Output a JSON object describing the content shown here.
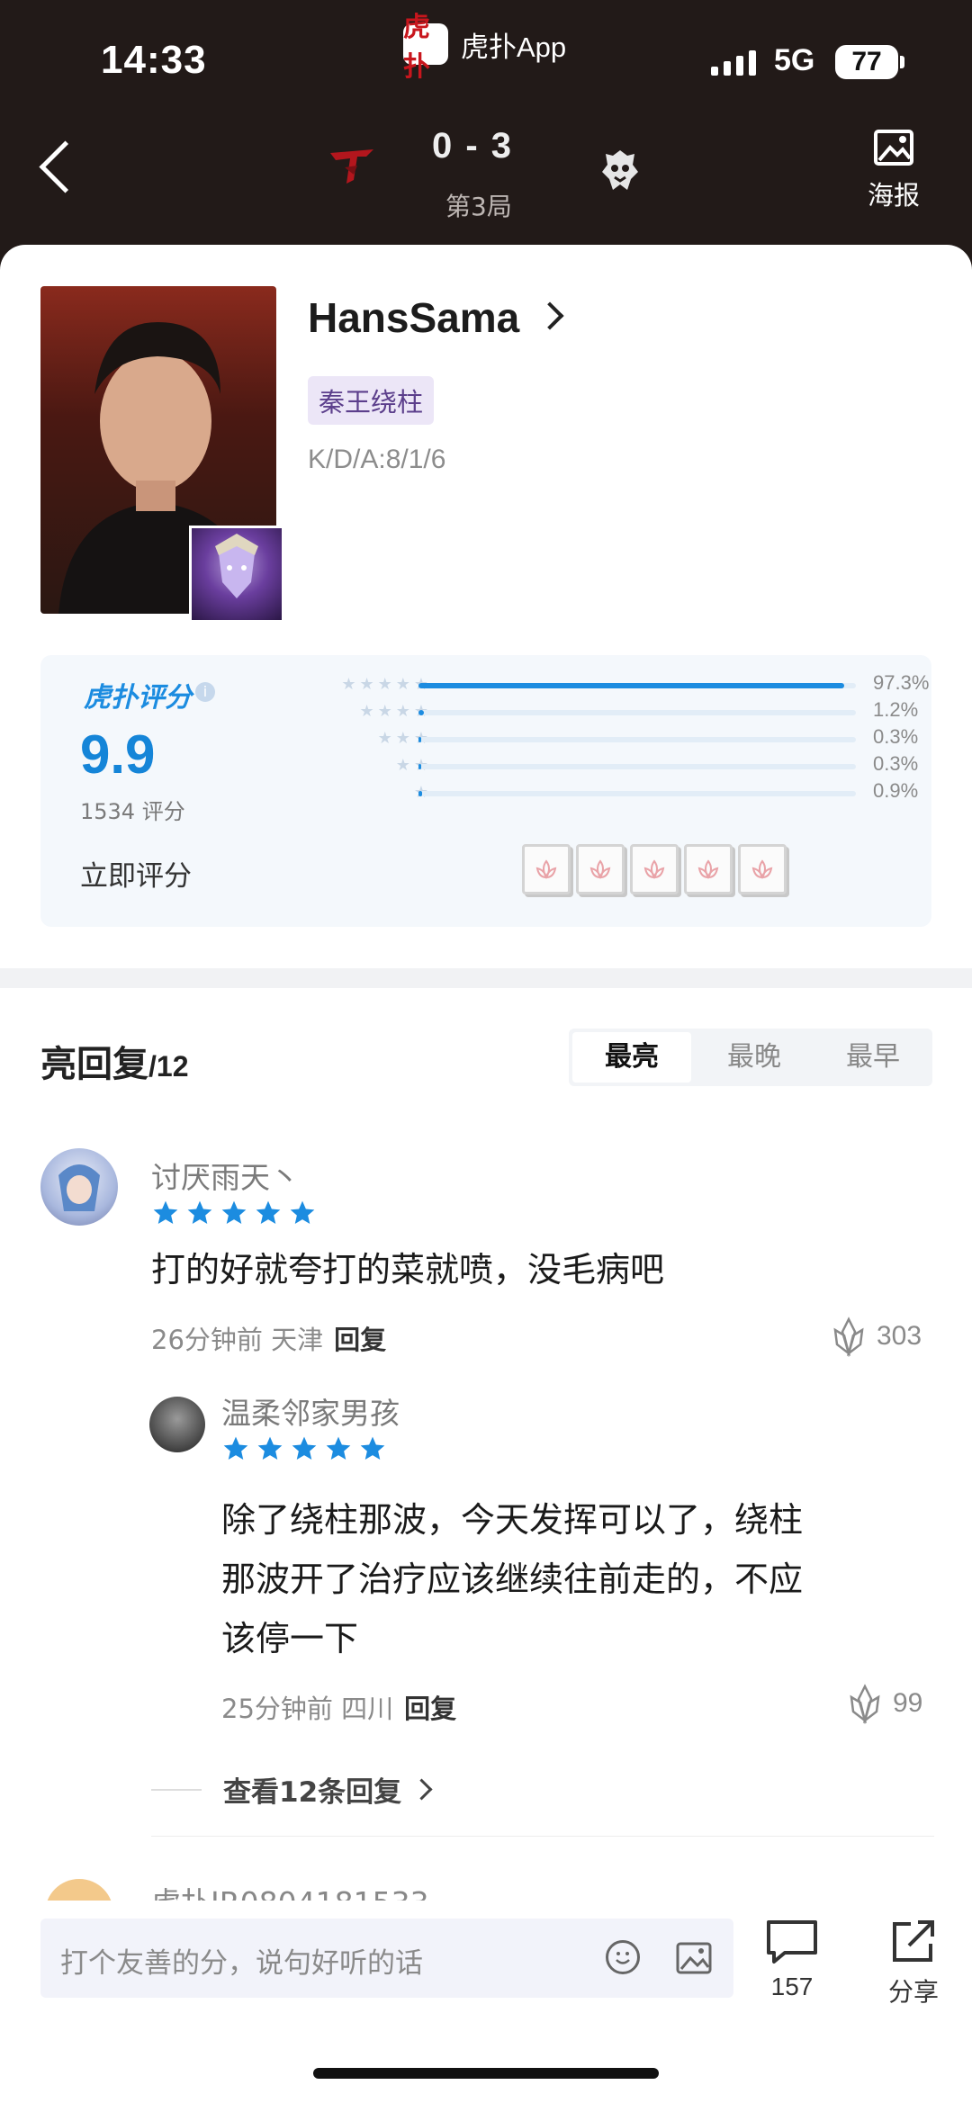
{
  "status_bar": {
    "time": "14:33",
    "app_name": "虎扑App",
    "app_logo_text": "虎扑",
    "network": "5G",
    "battery": "77"
  },
  "header": {
    "score": "0 - 3",
    "round": "第3局",
    "poster_label": "海报"
  },
  "player": {
    "name": "HansSama",
    "tag": "秦王绕柱",
    "kda": "K/D/A:8/1/6"
  },
  "rating": {
    "logo": "虎扑评分",
    "score": "9.9",
    "count": "1534 评分",
    "rate_now": "立即评分",
    "rows": [
      {
        "stars": "★★★★★",
        "fill": 0.973,
        "pct": "97.3%"
      },
      {
        "stars": "★★★★",
        "fill": 0.012,
        "pct": "1.2%"
      },
      {
        "stars": "★★★",
        "fill": 0.003,
        "pct": "0.3%"
      },
      {
        "stars": "★★",
        "fill": 0.003,
        "pct": "0.3%"
      },
      {
        "stars": "★",
        "fill": 0.009,
        "pct": "0.9%"
      }
    ]
  },
  "comments_section": {
    "title": "亮回复",
    "count": "/12",
    "sort": [
      "最亮",
      "最晚",
      "最早"
    ]
  },
  "comments": [
    {
      "user": "讨厌雨天丶",
      "stars": 5,
      "text": "打的好就夸打的菜就喷，没毛病吧",
      "time": "26分钟前 天津",
      "reply": "回复",
      "likes": "303"
    },
    {
      "user": "温柔邻家男孩",
      "stars": 5,
      "text_lines": [
        "除了绕柱那波，今天发挥可以了，绕柱",
        "那波开了治疗应该继续往前走的，不应",
        "该停一下"
      ],
      "time": "25分钟前 四川",
      "reply": "回复",
      "likes": "99"
    }
  ],
  "view_more": "查看12条回复",
  "next_user_partial": "虎扑JR0804181533",
  "bottom_bar": {
    "placeholder": "打个友善的分，说句好听的话",
    "comment_count": "157",
    "share_label": "分享"
  },
  "colors": {
    "header_bg": "#221a18",
    "accent_blue": "#1c8ce0",
    "star_blue": "#1c8ce0"
  }
}
